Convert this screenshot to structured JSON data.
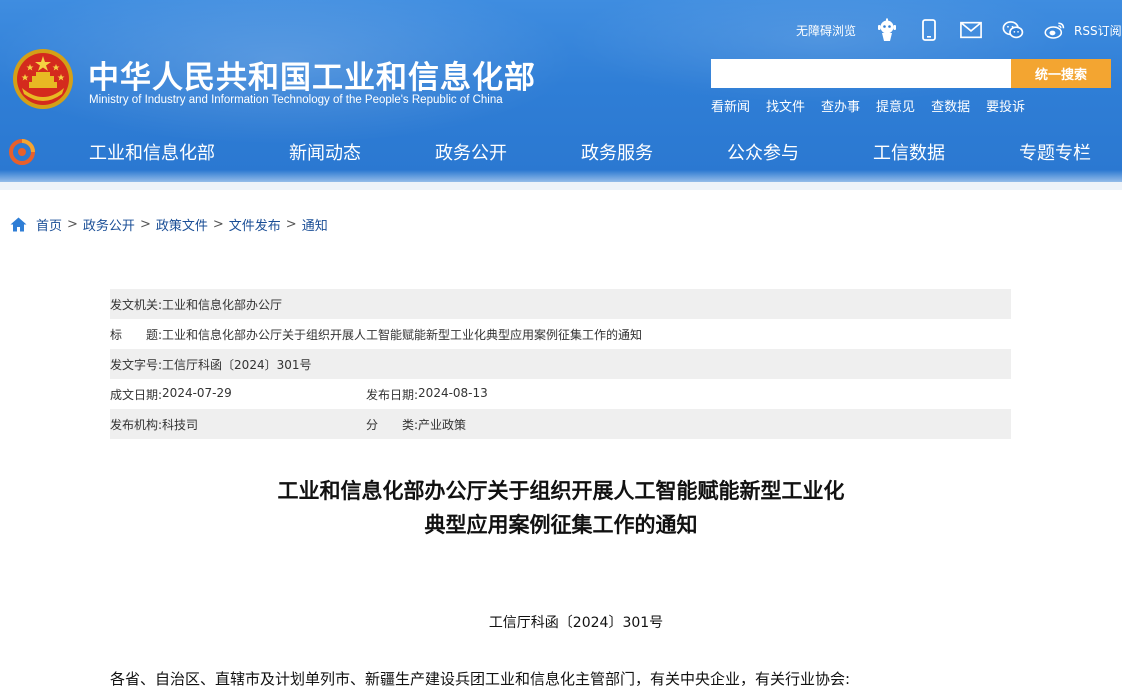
{
  "header": {
    "title_cn": "中华人民共和国工业和信息化部",
    "title_en": "Ministry of Industry and Information Technology of the People's Republic of China",
    "toolbar": {
      "accessibility": "无障碍浏览",
      "rss": "RSS订阅",
      "icons": [
        "robot-icon",
        "mobile-icon",
        "mail-icon",
        "wechat-icon",
        "weibo-icon"
      ]
    },
    "search": {
      "placeholder": "",
      "button": "统一搜索"
    },
    "quick_links": [
      "看新闻",
      "找文件",
      "查办事",
      "提意见",
      "查数据",
      "要投诉"
    ],
    "nav": [
      "工业和信息化部",
      "新闻动态",
      "政务公开",
      "政务服务",
      "公众参与",
      "工信数据",
      "专题专栏"
    ]
  },
  "breadcrumb": [
    "首页",
    "政务公开",
    "政策文件",
    "文件发布",
    "通知"
  ],
  "meta": {
    "issuer_label": "发文机关:",
    "issuer": "工业和信息化部办公厅",
    "subject_label": "标　　题:",
    "subject": "工业和信息化部办公厅关于组织开展人工智能赋能新型工业化典型应用案例征集工作的通知",
    "doc_no_label": "发文字号:",
    "doc_no": "工信厅科函〔2024〕301号",
    "written_label": "成文日期:",
    "written": "2024-07-29",
    "published_label": "发布日期:",
    "published": "2024-08-13",
    "org_label": "发布机构:",
    "org": "科技司",
    "category_label": "分　　类:",
    "category": "产业政策"
  },
  "article": {
    "title_line1": "工业和信息化部办公厅关于组织开展人工智能赋能新型工业化",
    "title_line2": "典型应用案例征集工作的通知",
    "doc_number": "工信厅科函〔2024〕301号",
    "salutation": "各省、自治区、直辖市及计划单列市、新疆生产建设兵团工业和信息化主管部门，有关中央企业，有关行业协会:"
  },
  "colors": {
    "header_blue": "#2f7ed6",
    "search_button": "#f3a531",
    "breadcrumb_link": "#1a4e96",
    "meta_shade": "#efefef"
  }
}
